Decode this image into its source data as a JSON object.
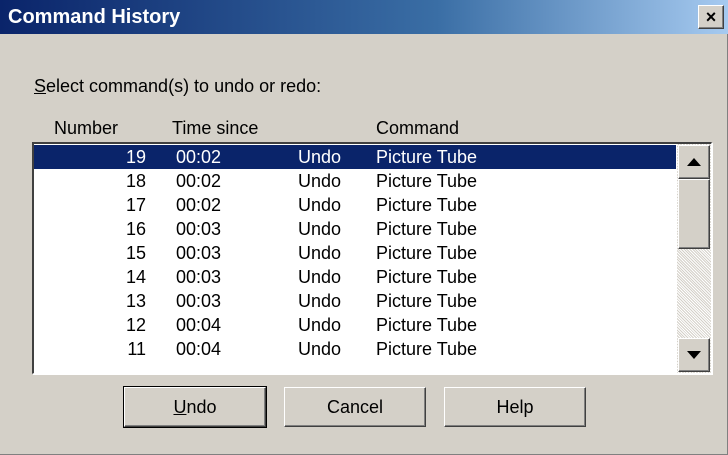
{
  "window": {
    "title": "Command History",
    "close_glyph": "×",
    "close_icon": "close-icon"
  },
  "prompt": {
    "mnemonic": "S",
    "rest": "elect command(s) to undo or redo:"
  },
  "columns": {
    "number": "Number",
    "time": "Time since",
    "command": "Command"
  },
  "rows": [
    {
      "number": "19",
      "time": "00:02",
      "action": "Undo",
      "command": "Picture Tube",
      "selected": true
    },
    {
      "number": "18",
      "time": "00:02",
      "action": "Undo",
      "command": "Picture Tube"
    },
    {
      "number": "17",
      "time": "00:02",
      "action": "Undo",
      "command": "Picture Tube"
    },
    {
      "number": "16",
      "time": "00:03",
      "action": "Undo",
      "command": "Picture Tube"
    },
    {
      "number": "15",
      "time": "00:03",
      "action": "Undo",
      "command": "Picture Tube"
    },
    {
      "number": "14",
      "time": "00:03",
      "action": "Undo",
      "command": "Picture Tube"
    },
    {
      "number": "13",
      "time": "00:03",
      "action": "Undo",
      "command": "Picture Tube"
    },
    {
      "number": "12",
      "time": "00:04",
      "action": "Undo",
      "command": "Picture Tube"
    },
    {
      "number": "11",
      "time": "00:04",
      "action": "Undo",
      "command": "Picture Tube"
    }
  ],
  "buttons": {
    "undo": {
      "mnemonic": "U",
      "rest": "ndo"
    },
    "cancel": "Cancel",
    "help": "Help"
  },
  "colors": {
    "selection": "#0a246a",
    "titlebar": "#0a246a",
    "face": "#d4d0c8"
  }
}
